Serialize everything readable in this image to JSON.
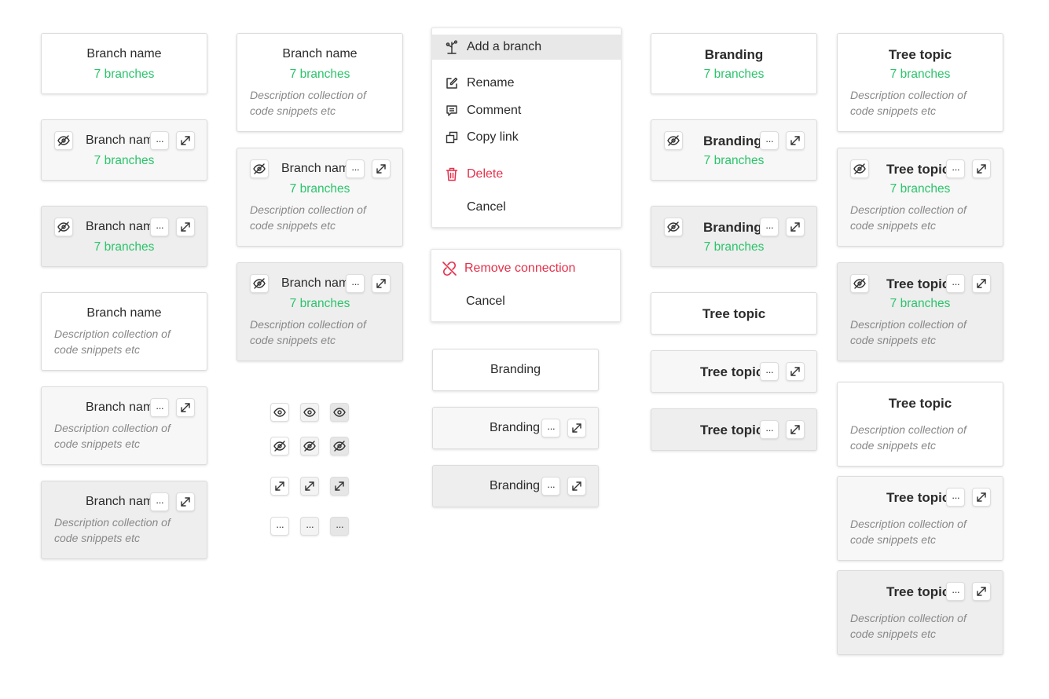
{
  "colors": {
    "count_green": "#2bc46b",
    "danger_red": "#e5304a",
    "description_gray": "#888888"
  },
  "icons": {
    "hide": "eye-off-icon",
    "show": "eye-icon",
    "expand": "expand-icon",
    "more": "more-dots-icon"
  },
  "more_glyph": "···",
  "col1": {
    "c1": {
      "title": "Branch name",
      "count": "7 branches"
    },
    "c2": {
      "title": "Branch name",
      "count": "7 branches"
    },
    "c3": {
      "title": "Branch name",
      "count": "7 branches"
    },
    "c4": {
      "title": "Branch name",
      "desc": "Description collection of code snippets etc"
    },
    "c5": {
      "title": "Branch name",
      "desc": "Description collection of code snippets etc"
    },
    "c6": {
      "title": "Branch name",
      "desc": "Description collection of code snippets etc"
    }
  },
  "col2": {
    "c1": {
      "title": "Branch name",
      "count": "7 branches",
      "desc": "Description collection of code snippets etc"
    },
    "c2": {
      "title": "Branch name",
      "count": "7 branches",
      "desc": "Description collection of code snippets etc"
    },
    "c3": {
      "title": "Branch name",
      "count": "7 branches",
      "desc": "Description collection of code snippets etc"
    }
  },
  "menu": {
    "add_branch": "Add a branch",
    "rename": "Rename",
    "comment": "Comment",
    "copy_link": "Copy link",
    "delete": "Delete",
    "cancel": "Cancel"
  },
  "menu2": {
    "remove_connection": "Remove connection",
    "cancel": "Cancel"
  },
  "col3": {
    "b1": "Branding",
    "b2": "Branding",
    "b3": "Branding"
  },
  "col4": {
    "c1": {
      "title": "Branding",
      "count": "7 branches"
    },
    "c2": {
      "title": "Branding",
      "count": "7 branches"
    },
    "c3": {
      "title": "Branding",
      "count": "7 branches"
    },
    "t1": "Tree topic",
    "t2": "Tree topic",
    "t3": "Tree topic"
  },
  "col5": {
    "c1": {
      "title": "Tree topic",
      "count": "7 branches",
      "desc": "Description collection of code snippets etc"
    },
    "c2": {
      "title": "Tree topic",
      "count": "7 branches",
      "desc": "Description collection of code snippets etc"
    },
    "c3": {
      "title": "Tree topic",
      "count": "7 branches",
      "desc": "Description collection of code snippets etc"
    },
    "c4": {
      "title": "Tree topic",
      "desc": "Description collection of code snippets etc"
    },
    "c5": {
      "title": "Tree topic",
      "desc": "Description collection of code snippets etc"
    },
    "c6": {
      "title": "Tree topic",
      "desc": "Description collection of code snippets etc"
    }
  }
}
